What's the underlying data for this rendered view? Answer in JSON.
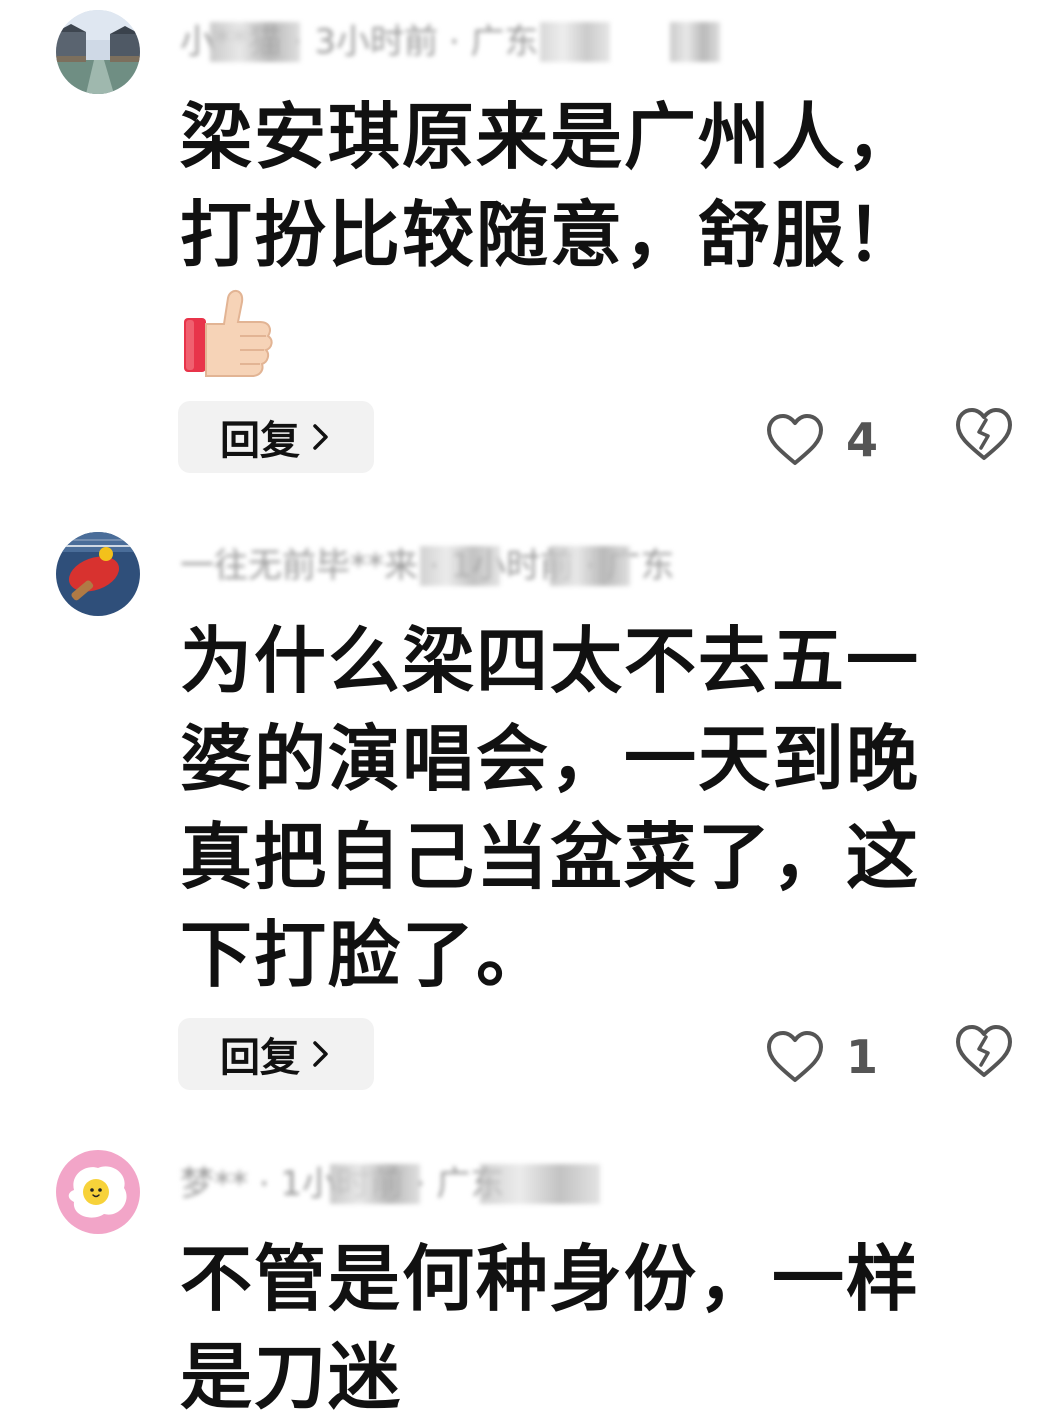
{
  "comments": [
    {
      "avatar_icon": "canal-town-avatar",
      "meta_text": "小**猫 · 3小时前 · 广东",
      "lines": [
        "梁安琪原来是广州人，",
        "打扮比较随意，舒服！"
      ],
      "emoji_icon": "thumbs-up-icon",
      "reply_label": "回复",
      "like_count": "4"
    },
    {
      "avatar_icon": "ping-pong-paddle-avatar",
      "meta_text": "一往无前毕**来 · 1小时前 · 广东",
      "lines": [
        "为什么梁四太不去五一",
        "婆的演唱会，一天到晚",
        "真把自己当盆菜了，这",
        "下打脸了。"
      ],
      "reply_label": "回复",
      "like_count": "1"
    },
    {
      "avatar_icon": "fried-egg-avatar",
      "meta_text": "梦** · 1小时前 · 广东",
      "lines": [
        "不管是何种身份，一样",
        "是刀迷"
      ]
    }
  ],
  "colors": {
    "text": "#111111",
    "meta": "#9a9a9a",
    "reply_bg": "#f2f2f2",
    "icon": "#555555"
  }
}
